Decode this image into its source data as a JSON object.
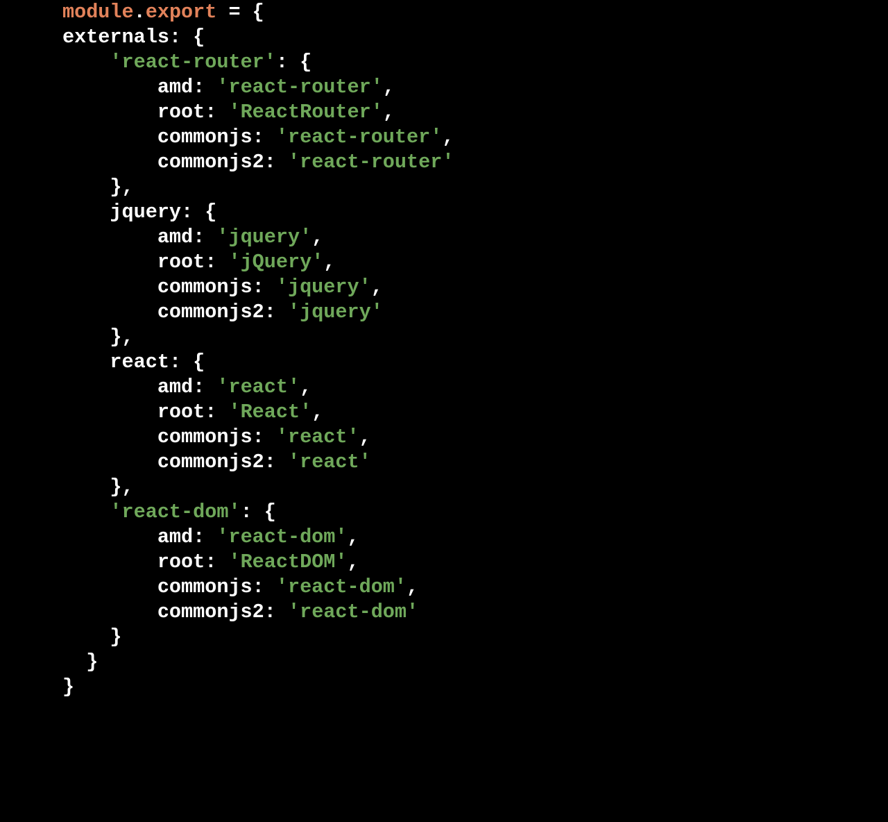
{
  "kw_module": "module",
  "dot": ".",
  "kw_export": "export",
  "eq": " = ",
  "ob": "{",
  "cb": "}",
  "comma": ",",
  "colon": ": ",
  "externals": "externals",
  "rr_key": "'react-router'",
  "amd": "amd",
  "root": "root",
  "commonjs": "commonjs",
  "commonjs2": "commonjs2",
  "jquery_key": "jquery",
  "react_key": "react",
  "rd_key": "'react-dom'",
  "s_react_router": "'react-router'",
  "s_ReactRouter": "'ReactRouter'",
  "s_jquery": "'jquery'",
  "s_jQuery": "'jQuery'",
  "s_react": "'react'",
  "s_React": "'React'",
  "s_react_dom": "'react-dom'",
  "s_ReactDOM": "'ReactDOM'"
}
